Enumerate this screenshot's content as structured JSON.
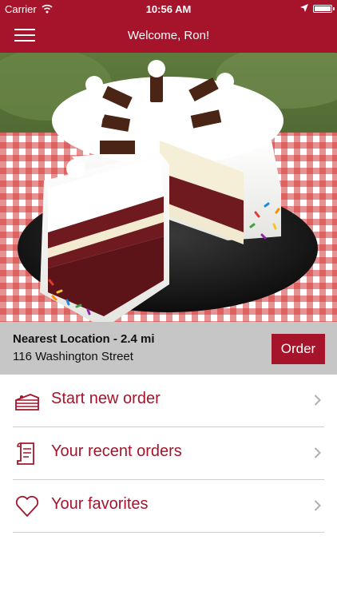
{
  "status_bar": {
    "carrier": "Carrier",
    "time": "10:56 AM",
    "icons": [
      "wifi-icon",
      "location-arrow-icon",
      "battery-icon"
    ]
  },
  "nav": {
    "title": "Welcome, Ron!",
    "menu_icon": "hamburger-menu-icon"
  },
  "hero": {
    "alt": "ice cream cake with sprinkles and chocolate pieces"
  },
  "location": {
    "title": "Nearest Location - 2.4 mi",
    "address": "116 Washington Street",
    "order_label": "Order"
  },
  "menu": [
    {
      "label": "Start new order",
      "icon": "cake-slice-icon"
    },
    {
      "label": "Your recent orders",
      "icon": "receipt-icon"
    },
    {
      "label": "Your favorites",
      "icon": "heart-icon"
    }
  ],
  "colors": {
    "brand": "#a5142a",
    "location_bar": "#c6c6c6",
    "divider": "#cfcfcf"
  }
}
